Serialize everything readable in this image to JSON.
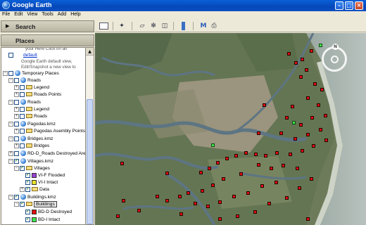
{
  "app": {
    "title": "Google Earth"
  },
  "menu": [
    "File",
    "Edit",
    "View",
    "Tools",
    "Add",
    "Help"
  ],
  "panels": {
    "search": {
      "label": "Search",
      "arrow": "▶"
    },
    "places": {
      "label": "Places"
    }
  },
  "tree": {
    "default_note_1": "your Here Click on an",
    "default_link": "default",
    "default_note_2": "Google Earth default view,",
    "default_note_3": "Edit/Snapshot a new view to",
    "temporary_places": "Temporary Places",
    "roads_1": "Roads",
    "legend_1": "Legend",
    "roads_points": "Roads Points",
    "roads_2": "Roads",
    "legend_2": "Legend",
    "roads_3": "Roads",
    "pagodas_kmz": "Pagodas.kmz",
    "pagodas_points": "Pagodas Asembly Points",
    "bridges_kmz": "Bridges.kmz",
    "bridges": "Bridges",
    "rd_d": "RD-D_Roads Destroyed Are",
    "villages_kmz": "Villages.kmz",
    "villages": "Villages",
    "vi_f": "VI-F Flooded",
    "vi_i": "VI-I Intact",
    "data": "Data",
    "buildings_kmz": "Buildings.kmz",
    "buildings": "Buildings",
    "bd_d": "BD-D Destroyed",
    "bd_i": "BD-I Intact"
  },
  "colors": {
    "vi_f": "#9a3fd6",
    "vi_i": "#e8e22a",
    "bd_d": "#e20d10",
    "bd_i": "#3fe64a",
    "marker_red": "#e20d10",
    "marker_green": "#3fe64a"
  },
  "toolbar_icons": [
    "sidebar-toggle-icon",
    "placemark-icon",
    "polygon-icon",
    "path-icon",
    "overlay-icon",
    "ruler-icon",
    "email-icon",
    "print-icon"
  ],
  "compass": {
    "label": "N"
  }
}
